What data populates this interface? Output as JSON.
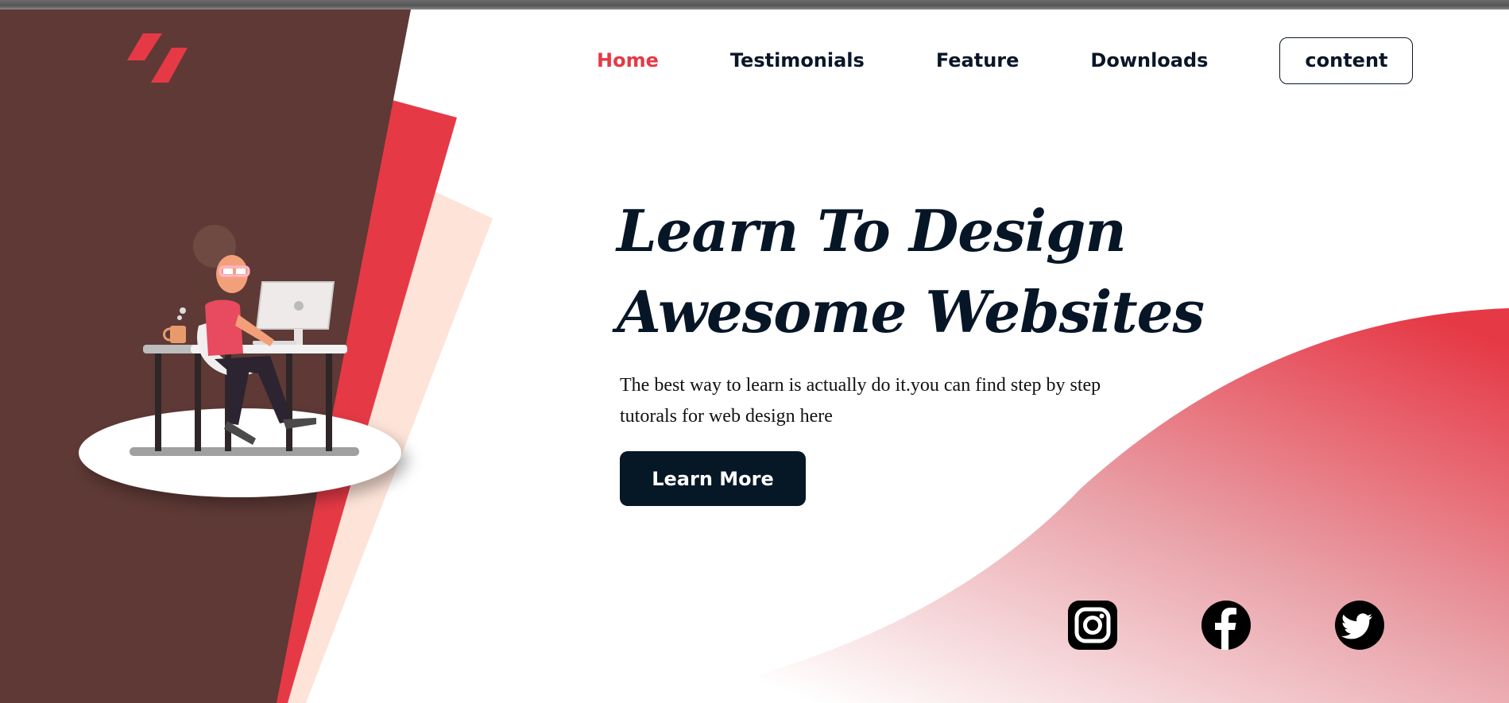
{
  "nav": {
    "links": [
      {
        "label": "Home",
        "active": true
      },
      {
        "label": "Testimonials",
        "active": false
      },
      {
        "label": "Feature",
        "active": false
      },
      {
        "label": "Downloads",
        "active": false
      }
    ],
    "cta_label": "content"
  },
  "hero": {
    "title_line1": "Learn To Design",
    "title_line2": "Awesome Websites",
    "description": "The best way to learn is actually do it.you can find step by step tutorals for web design here",
    "button_label": "Learn More"
  },
  "social": [
    {
      "icon": "instagram-icon"
    },
    {
      "icon": "facebook-icon"
    },
    {
      "icon": "twitter-icon"
    }
  ],
  "colors": {
    "accent": "#e63946",
    "dark_panel": "#5e3935",
    "navy": "#061726",
    "peach": "#fde3d8"
  }
}
